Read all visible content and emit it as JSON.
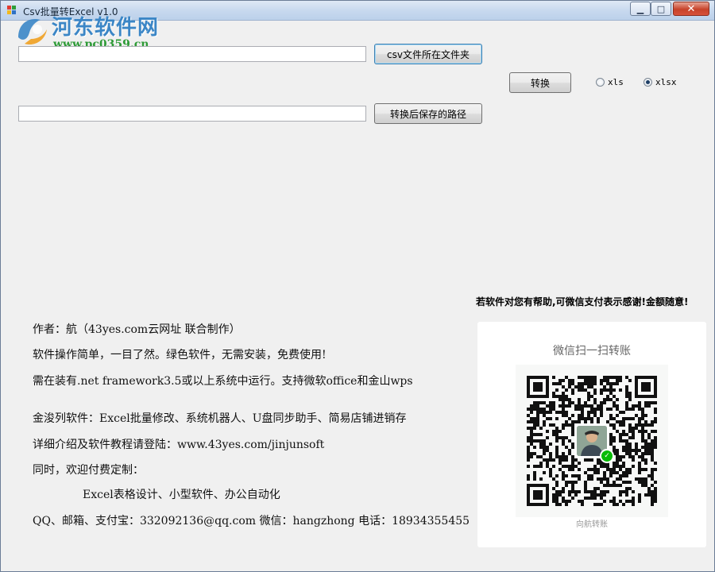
{
  "window": {
    "title": "Csv批量转Excel v1.0",
    "controls": {
      "minimize": "▁",
      "maximize": "□",
      "close": "✕"
    }
  },
  "watermark": {
    "name": "河东软件网",
    "url": "www.pc0359.cn"
  },
  "folder_row": {
    "input_value": "",
    "button_label": "csv文件所在文件夹"
  },
  "convert": {
    "button_label": "转换",
    "format_options": [
      {
        "label": "xls",
        "checked": false
      },
      {
        "label": "xlsx",
        "checked": true
      }
    ]
  },
  "output_row": {
    "input_value": "",
    "button_label": "转换后保存的路径"
  },
  "info": {
    "author": "作者：航（43yes.com云网址 联合制作）",
    "simple": "软件操作简单，一目了然。绿色软件，无需安装，免费使用!",
    "requirement": "需在装有.net framework3.5或以上系统中运行。支持微软office和金山wps",
    "series": "金浚列软件：Excel批量修改、系统机器人、U盘同步助手、简易店铺进销存",
    "details": "详细介绍及软件教程请登陆：www.43yes.com/jinjunsoft",
    "custom": "同时，欢迎付费定制：",
    "custom_items": "Excel表格设计、小型软件、办公自动化",
    "contact": "QQ、邮箱、支付宝：332092136@qq.com  微信：hangzhong 电话：18934355455"
  },
  "payment": {
    "thanks": "若软件对您有帮助,可微信支付表示感谢!金额随意!",
    "card_title": "微信扫一扫转账",
    "caption": "向航转账"
  },
  "colors": {
    "window_bg": "#f0f0f0",
    "wechat_green": "#09bb07",
    "watermark_blue": "#3b86c6",
    "watermark_green": "#2e9b37"
  }
}
